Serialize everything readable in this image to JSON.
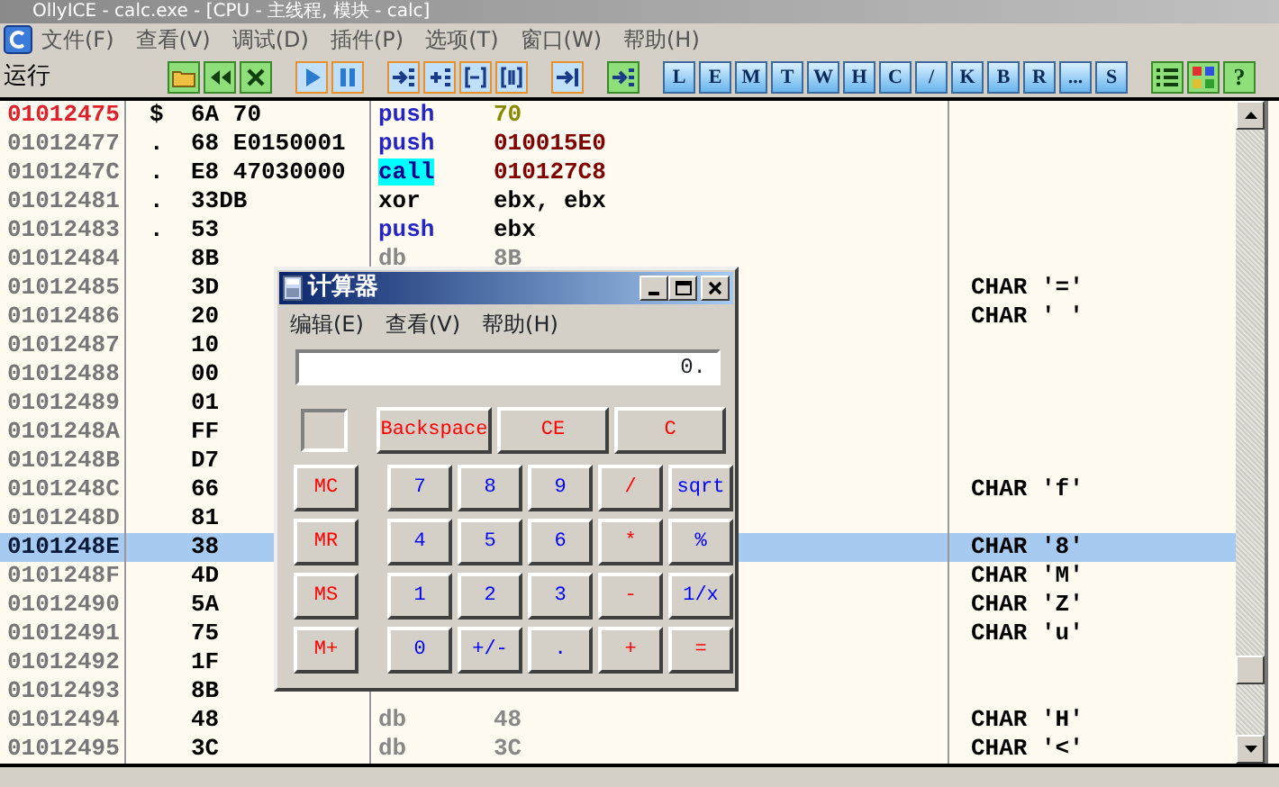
{
  "window": {
    "title": "OllyICE - calc.exe - [CPU - 主线程, 模块 - calc]"
  },
  "menu": [
    "文件(F)",
    "查看(V)",
    "调试(D)",
    "插件(P)",
    "选项(T)",
    "窗口(W)",
    "帮助(H)"
  ],
  "status": "运行",
  "toolbar": [
    [
      {
        "kind": "green"
      },
      {
        "kind": "green"
      },
      {
        "kind": "green"
      }
    ],
    [
      {
        "kind": "orange"
      },
      {
        "kind": "orange"
      }
    ],
    [
      {
        "kind": "orange"
      },
      {
        "kind": "orange"
      },
      {
        "kind": "orange"
      },
      {
        "kind": "orange"
      }
    ],
    [
      {
        "kind": "orange"
      }
    ],
    [
      {
        "kind": "green"
      }
    ],
    [
      {
        "kind": "letter",
        "label": "L"
      },
      {
        "kind": "letter",
        "label": "E"
      },
      {
        "kind": "letter",
        "label": "M"
      },
      {
        "kind": "letter",
        "label": "T"
      },
      {
        "kind": "letter",
        "label": "W"
      },
      {
        "kind": "letter",
        "label": "H"
      },
      {
        "kind": "letter",
        "label": "C"
      },
      {
        "kind": "letter",
        "label": "/"
      },
      {
        "kind": "letter",
        "label": "K"
      },
      {
        "kind": "letter",
        "label": "B"
      },
      {
        "kind": "letter",
        "label": "R"
      },
      {
        "kind": "letter",
        "label": "..."
      },
      {
        "kind": "letter",
        "label": "S"
      }
    ],
    [
      {
        "kind": "green"
      },
      {
        "kind": "green"
      },
      {
        "kind": "green",
        "label": "?"
      }
    ]
  ],
  "rows": [
    {
      "address": "01012475",
      "current": true,
      "selected": false,
      "marker": "$",
      "hex": "6A 70",
      "mnemonic": {
        "text": "push",
        "kind": "stack"
      },
      "operand": {
        "text": "70",
        "kind": "constant"
      }
    },
    {
      "address": "01012477",
      "current": false,
      "selected": false,
      "marker": ".",
      "hex": "68 E0150001",
      "mnemonic": {
        "text": "push",
        "kind": "stack"
      },
      "operand": {
        "text": "010015E0",
        "kind": "address"
      }
    },
    {
      "address": "0101247C",
      "current": false,
      "selected": false,
      "marker": ".",
      "hex": "E8 47030000",
      "mnemonic": {
        "text": "call",
        "kind": "call"
      },
      "operand": {
        "text": "010127C8",
        "kind": "address"
      }
    },
    {
      "address": "01012481",
      "current": false,
      "selected": false,
      "marker": ".",
      "hex": "33DB",
      "mnemonic": {
        "text": "xor",
        "kind": "plain"
      },
      "operand": {
        "text": "ebx, ebx",
        "kind": "register"
      }
    },
    {
      "address": "01012483",
      "current": false,
      "selected": false,
      "marker": ".",
      "hex": "53",
      "mnemonic": {
        "text": "push",
        "kind": "stack"
      },
      "operand": {
        "text": "ebx",
        "kind": "register"
      }
    },
    {
      "address": "01012484",
      "current": false,
      "selected": false,
      "hex": "8B",
      "mnemonic": {
        "text": "db",
        "kind": "data"
      },
      "operand": {
        "text": "8B",
        "kind": "data"
      }
    },
    {
      "address": "01012485",
      "current": false,
      "selected": false,
      "hex": "3D",
      "comment": "CHAR '='"
    },
    {
      "address": "01012486",
      "current": false,
      "selected": false,
      "hex": "20",
      "comment": "CHAR ' '"
    },
    {
      "address": "01012487",
      "current": false,
      "selected": false,
      "hex": "10"
    },
    {
      "address": "01012488",
      "current": false,
      "selected": false,
      "hex": "00"
    },
    {
      "address": "01012489",
      "current": false,
      "selected": false,
      "hex": "01"
    },
    {
      "address": "0101248A",
      "current": false,
      "selected": false,
      "hex": "FF"
    },
    {
      "address": "0101248B",
      "current": false,
      "selected": false,
      "hex": "D7"
    },
    {
      "address": "0101248C",
      "current": false,
      "selected": false,
      "hex": "66",
      "comment": "CHAR 'f'"
    },
    {
      "address": "0101248D",
      "current": false,
      "selected": false,
      "hex": "81"
    },
    {
      "address": "0101248E",
      "current": false,
      "selected": true,
      "hex": "38",
      "comment": "CHAR '8'"
    },
    {
      "address": "0101248F",
      "current": false,
      "selected": false,
      "hex": "4D",
      "comment": "CHAR 'M'"
    },
    {
      "address": "01012490",
      "current": false,
      "selected": false,
      "hex": "5A",
      "comment": "CHAR 'Z'"
    },
    {
      "address": "01012491",
      "current": false,
      "selected": false,
      "hex": "75",
      "comment": "CHAR 'u'"
    },
    {
      "address": "01012492",
      "current": false,
      "selected": false,
      "hex": "1F"
    },
    {
      "address": "01012493",
      "current": false,
      "selected": false,
      "hex": "8B"
    },
    {
      "address": "01012494",
      "current": false,
      "selected": false,
      "hex": "48",
      "mnemonic": {
        "text": "db",
        "kind": "data"
      },
      "operand": {
        "text": "48",
        "kind": "data"
      },
      "comment": "CHAR 'H'"
    },
    {
      "address": "01012495",
      "current": false,
      "selected": false,
      "hex": "3C",
      "mnemonic": {
        "text": "db",
        "kind": "data"
      },
      "operand": {
        "text": "3C",
        "kind": "data"
      },
      "comment": "CHAR '<'"
    }
  ],
  "calculator": {
    "title": "计算器",
    "menu": [
      "编辑(E)",
      "查看(V)",
      "帮助(H)"
    ],
    "display": "0.",
    "top_buttons": [
      {
        "label": "Backspace",
        "color": "#ff0000"
      },
      {
        "label": "CE",
        "color": "#ff0000"
      },
      {
        "label": "C",
        "color": "#ff0000"
      }
    ],
    "keypad": [
      [
        {
          "label": "MC",
          "color": "#ff0000"
        },
        {
          "label": "7",
          "color": "#0000ff"
        },
        {
          "label": "8",
          "color": "#0000ff"
        },
        {
          "label": "9",
          "color": "#0000ff"
        },
        {
          "label": "/",
          "color": "#ff0000"
        },
        {
          "label": "sqrt",
          "color": "#0000ff"
        }
      ],
      [
        {
          "label": "MR",
          "color": "#ff0000"
        },
        {
          "label": "4",
          "color": "#0000ff"
        },
        {
          "label": "5",
          "color": "#0000ff"
        },
        {
          "label": "6",
          "color": "#0000ff"
        },
        {
          "label": "*",
          "color": "#ff0000"
        },
        {
          "label": "%",
          "color": "#0000ff"
        }
      ],
      [
        {
          "label": "MS",
          "color": "#ff0000"
        },
        {
          "label": "1",
          "color": "#0000ff"
        },
        {
          "label": "2",
          "color": "#0000ff"
        },
        {
          "label": "3",
          "color": "#0000ff"
        },
        {
          "label": "-",
          "color": "#ff0000"
        },
        {
          "label": "1/x",
          "color": "#0000ff"
        }
      ],
      [
        {
          "label": "M+",
          "color": "#ff0000"
        },
        {
          "label": "0",
          "color": "#0000ff"
        },
        {
          "label": "+/-",
          "color": "#0000ff"
        },
        {
          "label": ".",
          "color": "#0000ff"
        },
        {
          "label": "+",
          "color": "#ff0000"
        },
        {
          "label": "=",
          "color": "#ff0000"
        }
      ]
    ]
  }
}
